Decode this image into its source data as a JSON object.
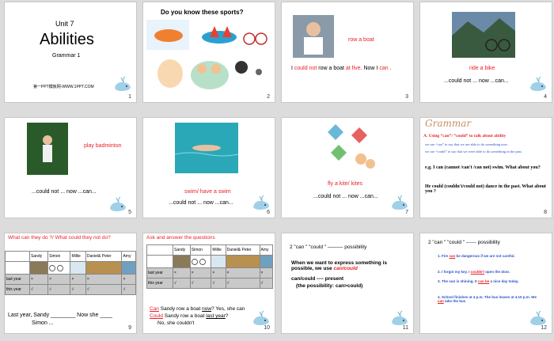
{
  "colors": {
    "red": "#e8202a",
    "blue": "#2a50c8",
    "gray": "#c9c9c9"
  },
  "slides": [
    {
      "num": "1",
      "unit": "Unit 7",
      "title": "Abilities",
      "subtitle": "Grammar 1",
      "footer": "第一PPT模板网-WWW.1PPT.COM"
    },
    {
      "num": "2",
      "heading": "Do you know these sports?"
    },
    {
      "num": "3",
      "caption": "row a boat",
      "body_a": "I ",
      "body_red1": "could not",
      "body_b": " row a boat ",
      "body_red2": "at five",
      "body_c": ".  Now I ",
      "body_red3": "can",
      "body_d": " ."
    },
    {
      "num": "4",
      "caption": "ride a bike",
      "body": "...could not ...        now  ...can..."
    },
    {
      "num": "5",
      "caption": "play badminton",
      "body": "...could not ...        now  ...can..."
    },
    {
      "num": "6",
      "caption": "swim/ have  a  swim",
      "body": "...could not ...        now  ...can..."
    },
    {
      "num": "7",
      "caption": "fly a kite/ kites",
      "body": "...could not ...        now  ...can..."
    },
    {
      "num": "8",
      "heading": "Grammar",
      "line_a": "A.  Using “can”/ “could” to talk about ability",
      "line_b": "we use “can” to say that we are able to do something now.",
      "line_c": "we use “could” to say that we were able to do something in the past.",
      "line_d": "e.g.  I can (cannot /can't /can not)  swim. What about you?",
      "line_e": "He  could (couldn't/could not) dance in the past. What  about you ?"
    },
    {
      "num": "9",
      "heading": "What can they do ?/ What could they not do?",
      "cols": [
        "Sandy",
        "Simon",
        "Millie",
        "Daniel& Peter",
        "Amy"
      ],
      "rows": [
        {
          "label": "last year",
          "cells": [
            "×",
            "×",
            "×",
            "×",
            "×"
          ]
        },
        {
          "label": "this year",
          "cells": [
            "√",
            "√",
            "√",
            "√",
            "√"
          ]
        }
      ],
      "q1": "Last year, Sandy ________ Now  she ____",
      "q2": "Simon ..."
    },
    {
      "num": "10",
      "heading": "Ask and answer the questions",
      "cols": [
        "Sandy",
        "Simon",
        "Millie",
        "Daniel& Peter",
        "Amy"
      ],
      "rows": [
        {
          "label": "last year",
          "cells": [
            "×",
            "×",
            "×",
            "×",
            "×"
          ]
        },
        {
          "label": "this year",
          "cells": [
            "√",
            "√",
            "√",
            "√",
            "√"
          ]
        }
      ],
      "q1_red": "Can",
      "q1": " Sandy row a boat ",
      "q1_u": "now",
      "q1_b": "?  Yes, she can",
      "q2_red": "Could",
      "q2": " Sandy row a boat ",
      "q2_u": "last year",
      "q2_b": "?",
      "q3": "No, she couldn't"
    },
    {
      "num": "11",
      "heading": "2 \"can \" \"could \" ——— possibility",
      "para1": "When we want to express something is possible, we use ",
      "para1_red": "can/could",
      "para2": "can/could ---- present",
      "para3": "(the possibility:  can>could)"
    },
    {
      "num": "12",
      "heading": "2 \"can \" \"could \"  ------  possibility",
      "items": [
        {
          "n": "1. Fire ",
          "blank": "can",
          "rest": " be dangerous if we are not careful."
        },
        {
          "n": "2. I forgot my key. I ",
          "blank": "couldn't",
          "rest": " open the door."
        },
        {
          "n": "3. The sun  is  shining. It ",
          "blank": "can be",
          "rest": " a nice day today."
        },
        {
          "n": "4. School finishes at 4 p.m. The bus leaves at 4.10 p.m. We ",
          "blank": "can",
          "rest": " take the bus"
        }
      ]
    }
  ]
}
